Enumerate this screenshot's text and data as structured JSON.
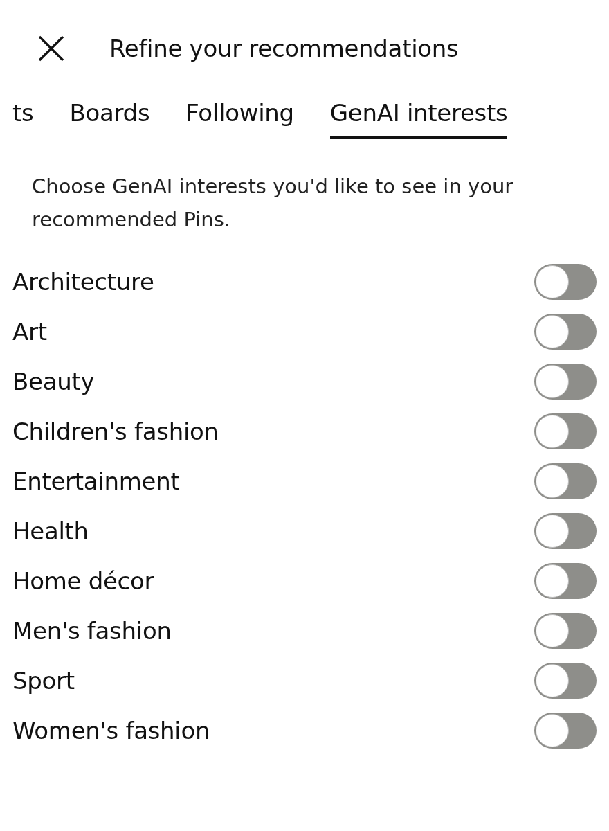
{
  "header": {
    "title": "Refine your recommendations"
  },
  "tabs": [
    {
      "label": "ts",
      "selected": false
    },
    {
      "label": "Boards",
      "selected": false
    },
    {
      "label": "Following",
      "selected": false
    },
    {
      "label": "GenAI interests",
      "selected": true
    }
  ],
  "description": "Choose GenAI interests you'd like to see in your recommended Pins.",
  "interests": [
    {
      "label": "Architecture",
      "on": false
    },
    {
      "label": "Art",
      "on": false
    },
    {
      "label": "Beauty",
      "on": false
    },
    {
      "label": "Children's fashion",
      "on": false
    },
    {
      "label": "Entertainment",
      "on": false
    },
    {
      "label": "Health",
      "on": false
    },
    {
      "label": "Home décor",
      "on": false
    },
    {
      "label": "Men's fashion",
      "on": false
    },
    {
      "label": "Sport",
      "on": false
    },
    {
      "label": "Women's fashion",
      "on": false
    }
  ]
}
